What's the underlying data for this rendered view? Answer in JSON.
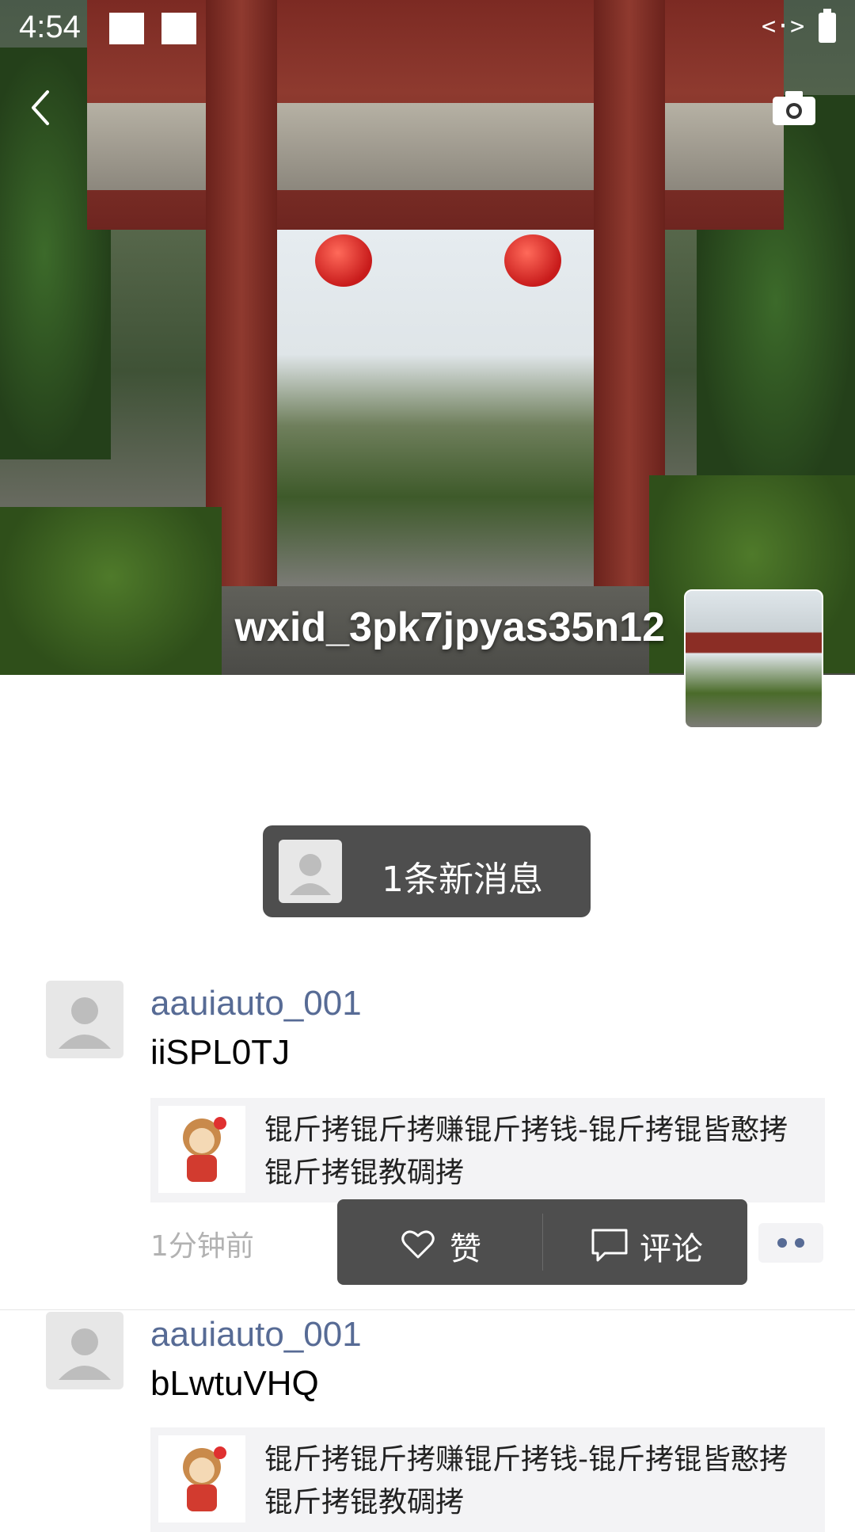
{
  "status_bar": {
    "time": "4:54"
  },
  "profile": {
    "username": "wxid_3pk7jpyas35n12"
  },
  "new_message": {
    "label": "1条新消息"
  },
  "posts": [
    {
      "author": "aauiauto_001",
      "text": "iiSPL0TJ",
      "link_title": "锟斤拷锟斤拷赚锟斤拷钱-锟斤拷锟皆憨拷锟斤拷锟教碉拷",
      "time": "1分钟前"
    },
    {
      "author": "aauiauto_001",
      "text": "bLwtuVHQ",
      "link_title": "锟斤拷锟斤拷赚锟斤拷钱-锟斤拷锟皆憨拷锟斤拷锟教碉拷"
    }
  ],
  "action_popup": {
    "like_label": "赞",
    "comment_label": "评论"
  },
  "icons": {
    "back": "back-arrow-icon",
    "camera": "camera-icon",
    "like": "heart-icon",
    "comment": "comment-icon",
    "more": "more-dots-icon"
  }
}
